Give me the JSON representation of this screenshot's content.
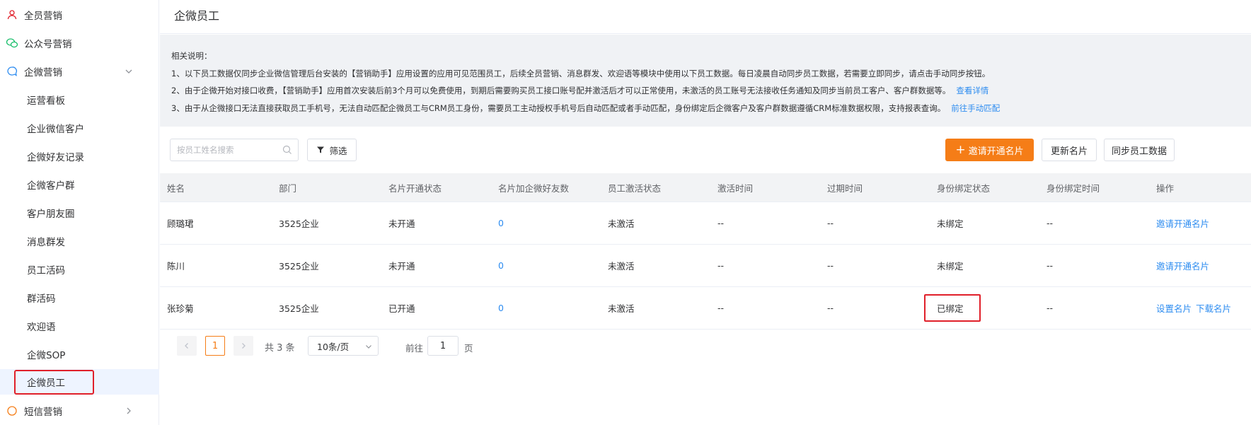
{
  "sidebar": {
    "items": [
      {
        "label": "全员营销",
        "icon": "member-icon"
      },
      {
        "label": "公众号营销",
        "icon": "wechat-icon"
      },
      {
        "label": "企微营销",
        "icon": "chat-bubble-icon"
      },
      {
        "label": "运营看板"
      },
      {
        "label": "企业微信客户"
      },
      {
        "label": "企微好友记录"
      },
      {
        "label": "企微客户群"
      },
      {
        "label": "客户朋友圈"
      },
      {
        "label": "消息群发"
      },
      {
        "label": "员工活码"
      },
      {
        "label": "群活码"
      },
      {
        "label": "欢迎语"
      },
      {
        "label": "企微SOP"
      },
      {
        "label": "企微员工"
      },
      {
        "label": "短信营销",
        "icon": "sms-icon"
      }
    ]
  },
  "page": {
    "title": "企微员工"
  },
  "notice": {
    "heading": "相关说明：",
    "line1": "1、以下员工数据仅同步企业微信管理后台安装的【营销助手】应用设置的应用可见范围员工，后续全员营销、消息群发、欢迎语等模块中使用以下员工数据。每日凌晨自动同步员工数据，若需要立即同步，请点击手动同步按钮。",
    "line2": "2、由于企微开始对接口收费，【营销助手】应用首次安装后前3个月可以免费使用，到期后需要购买员工接口账号配并激活后才可以正常使用，未激活的员工账号无法接收任务通知及同步当前员工客户、客户群数据等。",
    "line2_link": "查看详情",
    "line3": "3、由于从企微接口无法直接获取员工手机号，无法自动匹配企微员工与CRM员工身份，需要员工主动授权手机号后自动匹配或者手动匹配，身份绑定后企微客户及客户群数据遵循CRM标准数据权限，支持报表查询。",
    "line3_link": "前往手动匹配"
  },
  "toolbar": {
    "search_placeholder": "按员工姓名搜索",
    "filter_label": "筛选",
    "invite_label": "邀请开通名片",
    "update_label": "更新名片",
    "sync_label": "同步员工数据"
  },
  "table": {
    "headers": [
      "姓名",
      "部门",
      "名片开通状态",
      "名片加企微好友数",
      "员工激活状态",
      "激活时间",
      "过期时间",
      "身份绑定状态",
      "身份绑定时间",
      "操作"
    ],
    "rows": [
      {
        "name": "顾璐珺",
        "dept": "3525企业",
        "card_status": "未开通",
        "friends": "0",
        "activate": "未激活",
        "activate_time": "--",
        "expire_time": "--",
        "bind_status": "未绑定",
        "bind_time": "--",
        "ops": [
          "邀请开通名片"
        ]
      },
      {
        "name": "陈川",
        "dept": "3525企业",
        "card_status": "未开通",
        "friends": "0",
        "activate": "未激活",
        "activate_time": "--",
        "expire_time": "--",
        "bind_status": "未绑定",
        "bind_time": "--",
        "ops": [
          "邀请开通名片"
        ]
      },
      {
        "name": "张珍菊",
        "dept": "3525企业",
        "card_status": "已开通",
        "friends": "0",
        "activate": "未激活",
        "activate_time": "--",
        "expire_time": "--",
        "bind_status": "已绑定",
        "bind_time": "--",
        "ops": [
          "设置名片",
          "下载名片"
        ]
      }
    ]
  },
  "pagination": {
    "current": "1",
    "total": "共 3 条",
    "page_size": "10条/页",
    "goto_label": "前往",
    "goto_value": "1",
    "unit": "页"
  },
  "colors": {
    "accent": "#f57d17",
    "link": "#2d8cf0",
    "highlight": "#e0202a"
  }
}
